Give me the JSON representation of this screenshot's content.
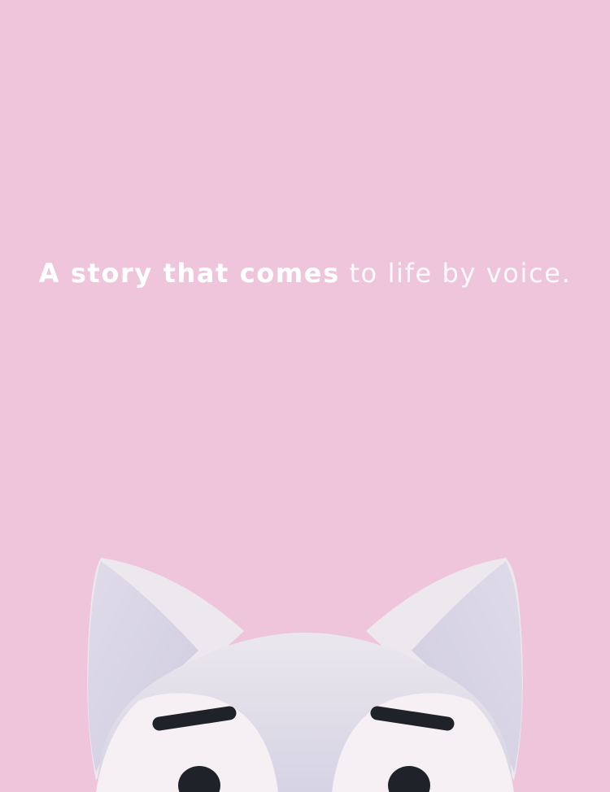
{
  "tagline": {
    "bold": "A story that comes",
    "light": "to life by voice."
  },
  "colors": {
    "background": "#efc5dc",
    "text": "#ffffff",
    "fur_outer": "#e7e3ea",
    "fur_inner": "#dcd8e6",
    "face_white": "#f6f0f4",
    "eye": "#1f2329"
  },
  "illustration": {
    "name": "fox-mascot",
    "icon": "fox-face-icon"
  }
}
